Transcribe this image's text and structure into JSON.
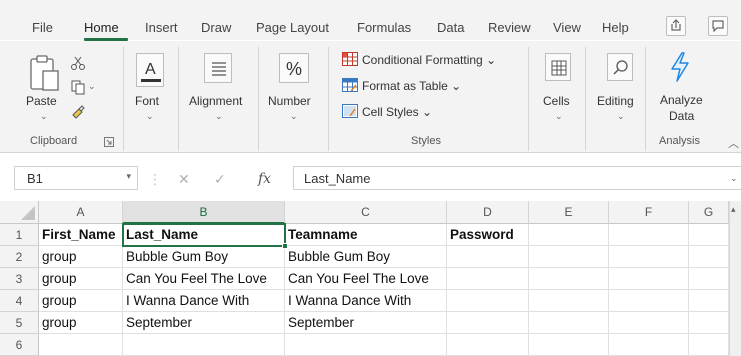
{
  "tabs": [
    {
      "label": "File"
    },
    {
      "label": "Home"
    },
    {
      "label": "Insert"
    },
    {
      "label": "Draw"
    },
    {
      "label": "Page Layout"
    },
    {
      "label": "Formulas"
    },
    {
      "label": "Data"
    },
    {
      "label": "Review"
    },
    {
      "label": "View"
    },
    {
      "label": "Help"
    }
  ],
  "active_tab": "Home",
  "ribbon": {
    "paste": "Paste",
    "clipboard": "Clipboard",
    "font": "Font",
    "alignment": "Alignment",
    "number": "Number",
    "number_symbol": "%",
    "conditional_formatting": "Conditional Formatting",
    "format_as_table": "Format as Table",
    "cell_styles": "Cell Styles",
    "styles": "Styles",
    "cells": "Cells",
    "editing": "Editing",
    "analyze_data_1": "Analyze",
    "analyze_data_2": "Data",
    "analysis": "Analysis"
  },
  "formula_bar": {
    "name_box": "B1",
    "fx": "fx",
    "content": "Last_Name"
  },
  "grid": {
    "columns": [
      "A",
      "B",
      "C",
      "D",
      "E",
      "F",
      "G"
    ],
    "selected_column": "B",
    "row_numbers": [
      "1",
      "2",
      "3",
      "4",
      "5",
      "6"
    ],
    "rows": [
      [
        "First_Name",
        "Last_Name",
        "Teamname",
        "Password",
        "",
        "",
        ""
      ],
      [
        "group",
        "Bubble Gum Boy",
        "Bubble Gum Boy",
        "",
        "",
        "",
        ""
      ],
      [
        "group",
        "Can You Feel The Love",
        "Can You Feel The Love",
        "",
        "",
        "",
        ""
      ],
      [
        "group",
        "I Wanna Dance With",
        "I Wanna Dance With",
        "",
        "",
        "",
        ""
      ],
      [
        "group",
        "September",
        "September",
        "",
        "",
        "",
        ""
      ],
      [
        "",
        "",
        "",
        "",
        "",
        "",
        ""
      ]
    ]
  },
  "colors": {
    "accent": "#217346",
    "analyze_icon": "#1e88e5"
  }
}
